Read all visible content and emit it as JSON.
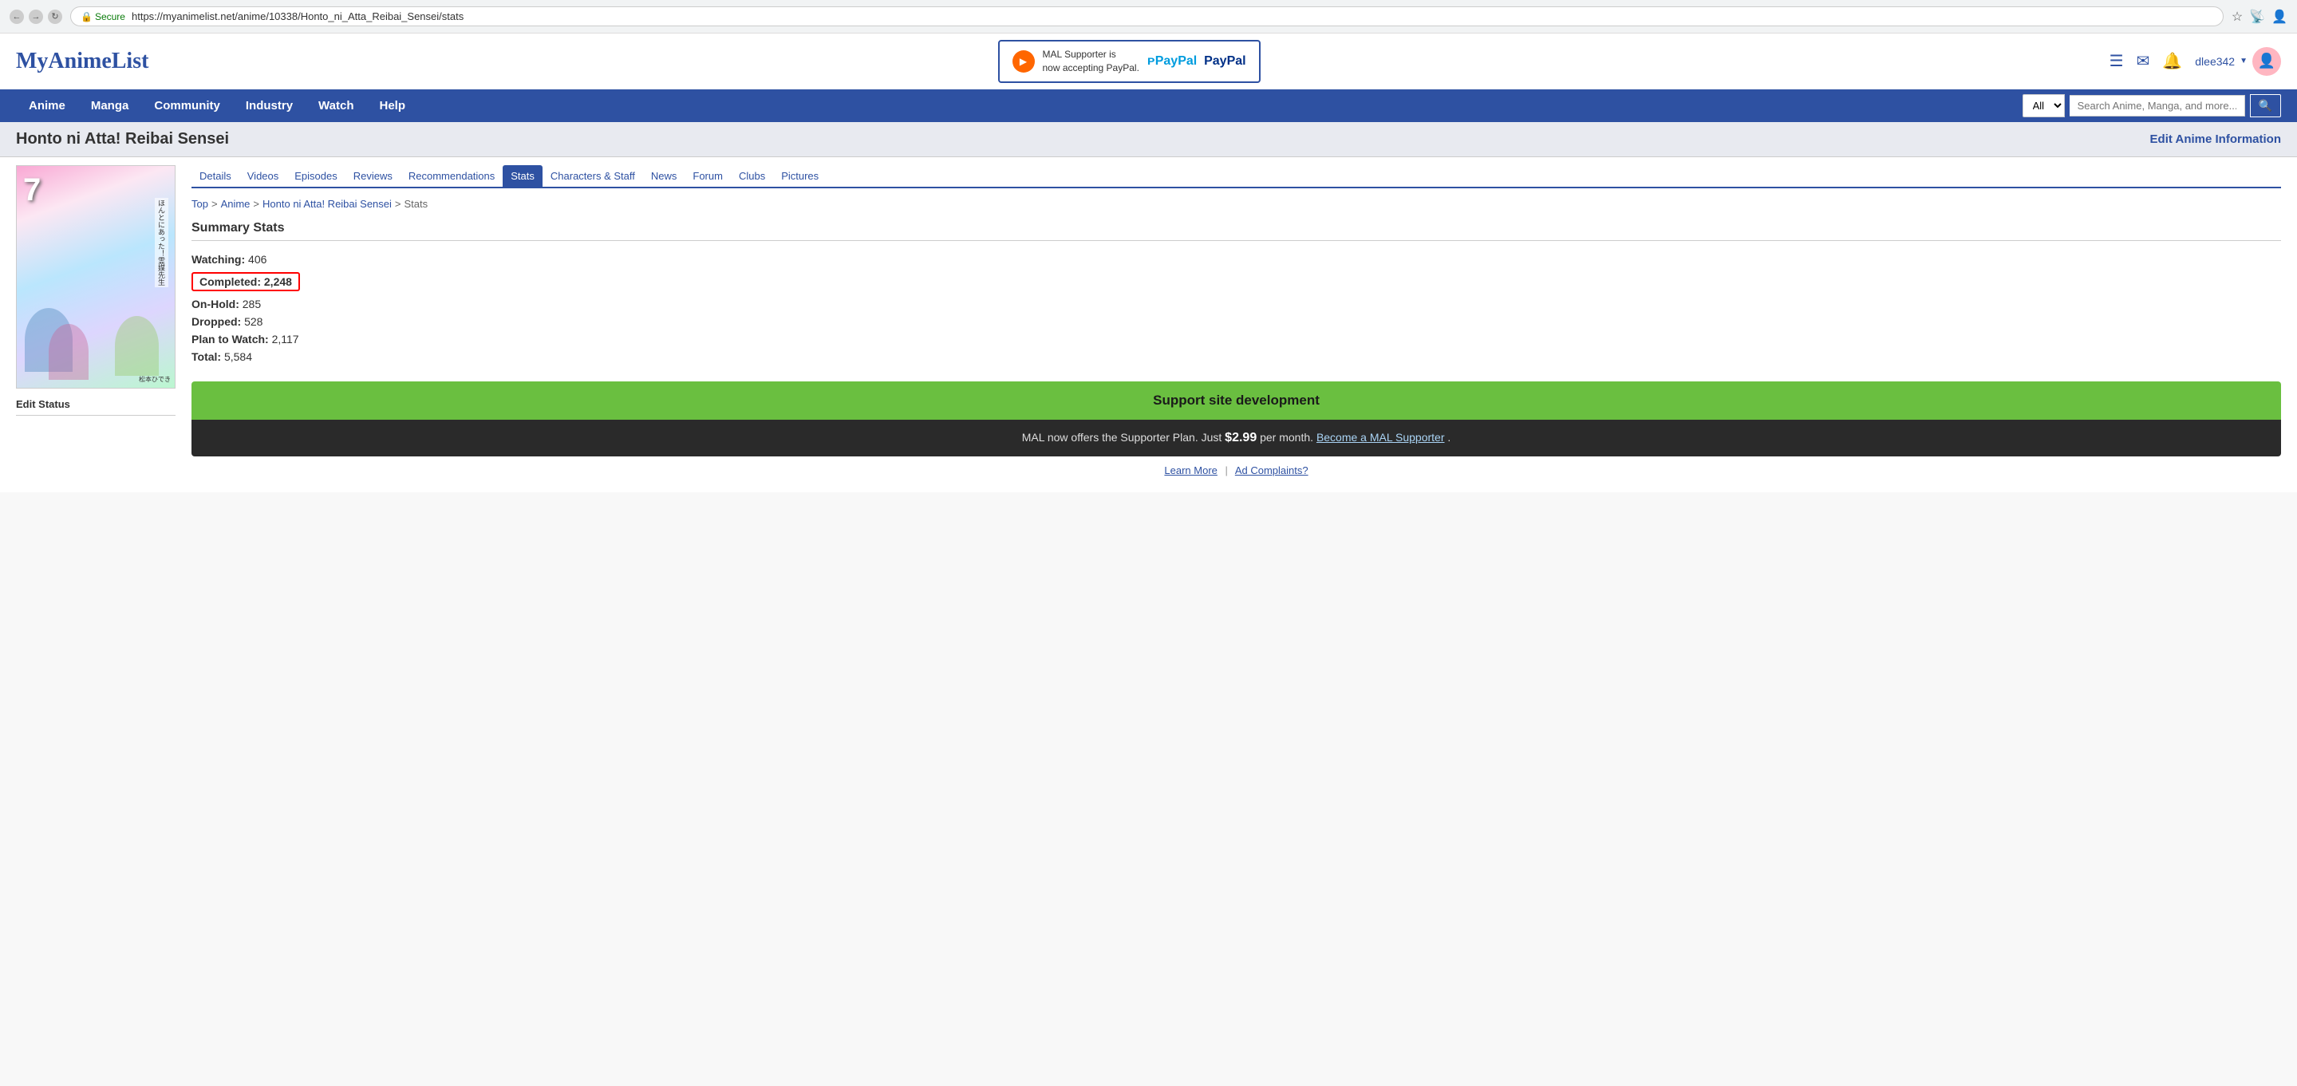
{
  "browser": {
    "url": "https://myanimelist.net/anime/10338/Honto_ni_Atta_Reibai_Sensei/stats",
    "secure_label": "Secure"
  },
  "site": {
    "logo": "MyAnimeList",
    "banner": {
      "text_line1": "MAL Supporter is",
      "text_line2": "now accepting PayPal.",
      "paypal_label": "PayPal"
    },
    "user": {
      "name": "dlee342",
      "avatar_icon": "👤"
    }
  },
  "nav": {
    "items": [
      "Anime",
      "Manga",
      "Community",
      "Industry",
      "Watch",
      "Help"
    ],
    "search": {
      "placeholder": "Search Anime, Manga, and more...",
      "select_default": "All"
    }
  },
  "page_title": "Honto ni Atta! Reibai Sensei",
  "edit_link": "Edit Anime Information",
  "tabs": [
    {
      "label": "Details",
      "active": false
    },
    {
      "label": "Videos",
      "active": false
    },
    {
      "label": "Episodes",
      "active": false
    },
    {
      "label": "Reviews",
      "active": false
    },
    {
      "label": "Recommendations",
      "active": false
    },
    {
      "label": "Stats",
      "active": true
    },
    {
      "label": "Characters & Staff",
      "active": false
    },
    {
      "label": "News",
      "active": false
    },
    {
      "label": "Forum",
      "active": false
    },
    {
      "label": "Clubs",
      "active": false
    },
    {
      "label": "Pictures",
      "active": false
    }
  ],
  "breadcrumb": {
    "items": [
      "Top",
      "Anime",
      "Honto ni Atta! Reibai Sensei",
      "Stats"
    ]
  },
  "stats": {
    "title": "Summary Stats",
    "rows": [
      {
        "label": "Watching:",
        "value": "406",
        "highlighted": false
      },
      {
        "label": "Completed:",
        "value": "2,248",
        "highlighted": true
      },
      {
        "label": "On-Hold:",
        "value": "285",
        "highlighted": false
      },
      {
        "label": "Dropped:",
        "value": "528",
        "highlighted": false
      },
      {
        "label": "Plan to Watch:",
        "value": "2,117",
        "highlighted": false
      },
      {
        "label": "Total:",
        "value": "5,584",
        "highlighted": false
      }
    ]
  },
  "sidebar": {
    "edit_status_label": "Edit Status"
  },
  "ad": {
    "top_text": "Support site development",
    "bottom_text_prefix": "MAL now offers the Supporter Plan. Just ",
    "price": "$2.99",
    "bottom_text_mid": " per month. ",
    "cta_link": "Become a MAL Supporter",
    "bottom_text_suffix": "."
  },
  "ad_footer": {
    "learn_more": "Learn More",
    "separator": "|",
    "ad_complaints": "Ad Complaints?"
  }
}
